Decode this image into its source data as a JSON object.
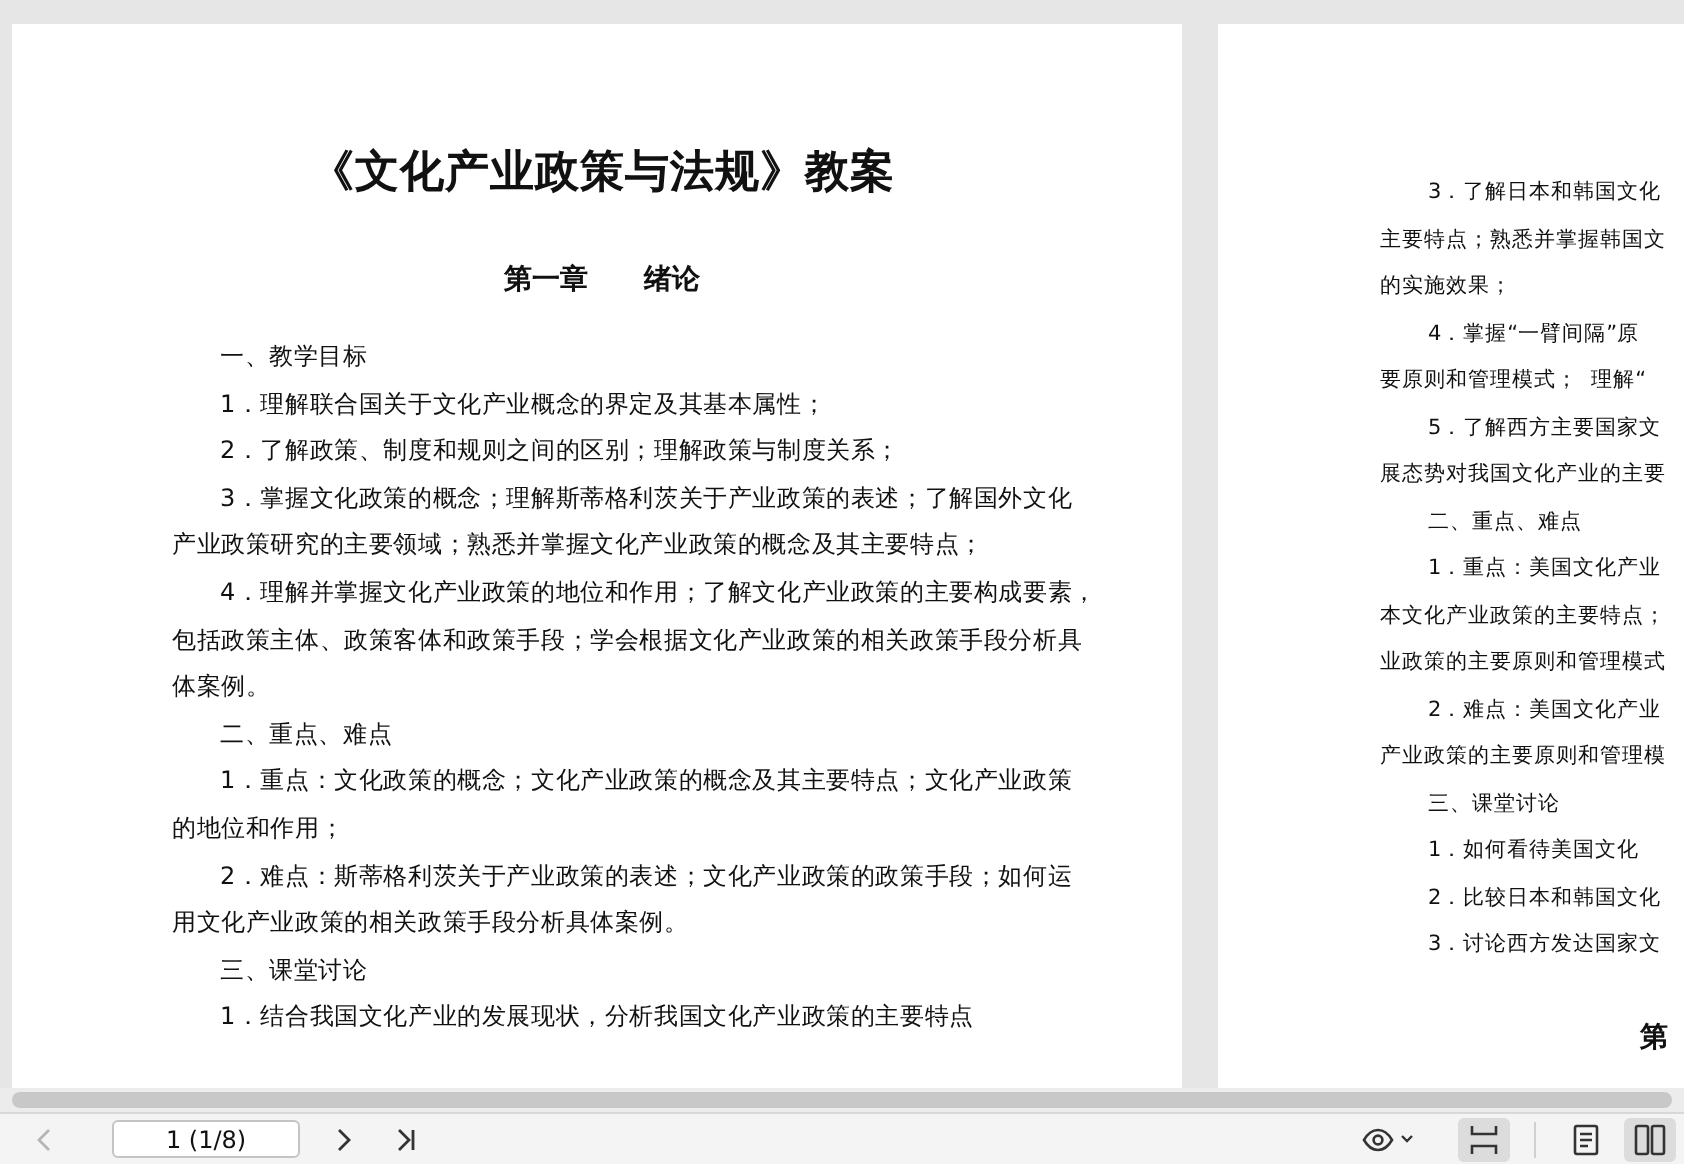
{
  "page_1": {
    "title": "《文化产业政策与法规》教案",
    "chapter": "第一章　　绪论",
    "paragraphs": [
      {
        "lines": [
          "一、教学目标"
        ]
      },
      {
        "lines": [
          "1．理解联合国关于文化产业概念的界定及其基本属性；"
        ]
      },
      {
        "lines": [
          "2．了解政策、制度和规则之间的区别；理解政策与制度关系；"
        ]
      },
      {
        "lines": [
          "3．掌握文化政策的概念；理解斯蒂格利茨关于产业政策的表述；了解国外文化",
          "产业政策研究的主要领域；熟悉并掌握文化产业政策的概念及其主要特点；"
        ]
      },
      {
        "lines": [
          "4．理解并掌握文化产业政策的地位和作用；了解文化产业政策的主要构成要素，",
          "包括政策主体、政策客体和政策手段；学会根据文化产业政策的相关政策手段分析具",
          "体案例。"
        ]
      },
      {
        "lines": [
          "二、重点、难点"
        ]
      },
      {
        "lines": [
          "1．重点：文化政策的概念；文化产业政策的概念及其主要特点；文化产业政策",
          "的地位和作用；"
        ]
      },
      {
        "lines": [
          "2．难点：斯蒂格利茨关于产业政策的表述；文化产业政策的政策手段；如何运",
          "用文化产业政策的相关政策手段分析具体案例。"
        ]
      },
      {
        "lines": [
          "三、课堂讨论"
        ]
      },
      {
        "lines": [
          "1．结合我国文化产业的发展现状，分析我国文化产业政策的主要特点"
        ]
      }
    ]
  },
  "page_2": {
    "paragraphs": [
      {
        "lines": [
          "3．了解日本和韩国文化",
          "主要特点；熟悉并掌握韩国文",
          "的实施效果；"
        ]
      },
      {
        "lines": [
          "4．掌握“一臂间隔”原",
          "要原则和管理模式；  理解“"
        ]
      },
      {
        "lines": [
          "5．了解西方主要国家文",
          "展态势对我国文化产业的主要"
        ]
      },
      {
        "lines": [
          "二、重点、难点"
        ]
      },
      {
        "lines": [
          "1．重点：美国文化产业",
          "本文化产业政策的主要特点；",
          "业政策的主要原则和管理模式"
        ]
      },
      {
        "lines": [
          "2．难点：美国文化产业",
          "产业政策的主要原则和管理模"
        ]
      },
      {
        "lines": [
          "三、课堂讨论"
        ]
      },
      {
        "lines": [
          "1．如何看待美国文化"
        ]
      },
      {
        "lines": [
          "2．比较日本和韩国文化"
        ]
      },
      {
        "lines": [
          "3．讨论西方发达国家文"
        ]
      }
    ],
    "chapter": "第"
  },
  "toolbar": {
    "previous": {
      "disabled": true
    },
    "page_field": {
      "value": "1 (1/8)"
    },
    "next": {
      "disabled": false
    },
    "view_buttons": [
      {
        "kind": "fit-width",
        "selected": true
      },
      {
        "kind": "single-page",
        "selected": false
      },
      {
        "kind": "two-page",
        "selected": true
      }
    ]
  }
}
